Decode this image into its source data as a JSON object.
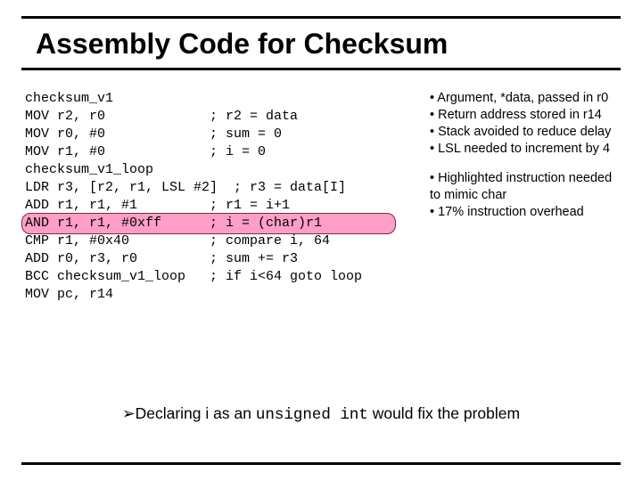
{
  "title": "Assembly Code for Checksum",
  "code": {
    "l0": "checksum_v1",
    "l1": "MOV r2, r0             ; r2 = data",
    "l2": "MOV r0, #0             ; sum = 0",
    "l3": "MOV r1, #0             ; i = 0",
    "l4": "checksum_v1_loop",
    "l5": "LDR r3, [r2, r1, LSL #2]  ; r3 = data[I]",
    "l6": "ADD r1, r1, #1         ; r1 = i+1",
    "l7": "AND r1, r1, #0xff      ; i = (char)r1",
    "l8": "CMP r1, #0x40          ; compare i, 64",
    "l9": "ADD r0, r3, r0         ; sum += r3",
    "l10": "BCC checksum_v1_loop   ; if i<64 goto loop",
    "l11": "MOV pc, r14"
  },
  "notes": {
    "a1": "• Argument, *data, passed in r0",
    "a2": "• Return address stored in r14",
    "a3": "• Stack avoided to reduce delay",
    "a4": "• LSL needed to increment by 4",
    "b1": "• Highlighted instruction needed to mimic char",
    "b2": "• 17% instruction overhead"
  },
  "conclusion": {
    "arrow": "➢",
    "pre": "Declaring i as an ",
    "mono": "unsigned int",
    "post": " would fix the problem"
  }
}
